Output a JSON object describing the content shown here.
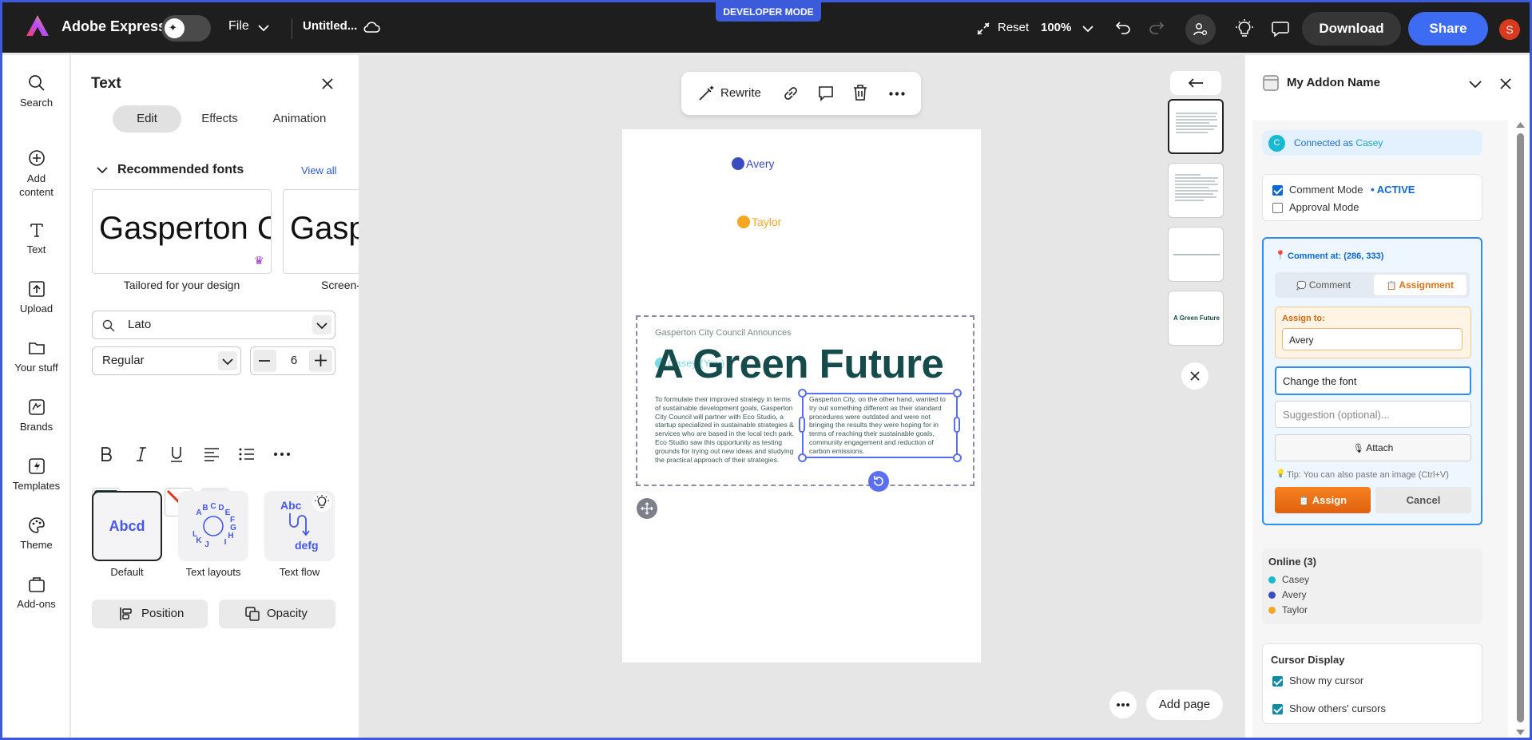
{
  "topbar": {
    "developer_mode": "DEVELOPER MODE",
    "app_name": "Adobe Express",
    "file_label": "File",
    "doc_title": "Untitled...",
    "reset_label": "Reset",
    "zoom": "100%",
    "download_label": "Download",
    "share_label": "Share",
    "avatar_initial": "S"
  },
  "rail": {
    "items": [
      {
        "label": "Search",
        "icon": "search-icon"
      },
      {
        "label": "Add content",
        "icon": "plus-circle-icon"
      },
      {
        "label": "Text",
        "icon": "text-icon"
      },
      {
        "label": "Upload",
        "icon": "upload-icon"
      },
      {
        "label": "Your stuff",
        "icon": "folder-icon"
      },
      {
        "label": "Brands",
        "icon": "brand-icon"
      },
      {
        "label": "Templates",
        "icon": "templates-icon"
      },
      {
        "label": "Theme",
        "icon": "palette-icon"
      },
      {
        "label": "Add-ons",
        "icon": "addons-icon"
      }
    ]
  },
  "text_panel": {
    "title": "Text",
    "tabs": [
      "Edit",
      "Effects",
      "Animation"
    ],
    "active_tab": "Edit",
    "recommended_title": "Recommended fonts",
    "view_all": "View all",
    "font_cards": [
      {
        "preview": "Gasperton C",
        "caption": "Tailored for your design"
      },
      {
        "preview": "Gasp",
        "caption": "Screen-"
      }
    ],
    "font_family": "Lato",
    "font_weight": "Regular",
    "font_size": "6",
    "text_color": "#164b4b",
    "presets": [
      {
        "label": "Default",
        "preview": "Abcd"
      },
      {
        "label": "Text layouts",
        "preview": "ABCDEFGHIJKL"
      },
      {
        "label": "Text flow",
        "preview_top": "Abc",
        "preview_bottom": "defg"
      }
    ],
    "position_label": "Position",
    "opacity_label": "Opacity"
  },
  "canvas": {
    "context_toolbar": {
      "rewrite_label": "Rewrite"
    },
    "cursors": [
      {
        "name": "Avery",
        "color": "#3b4cc0"
      },
      {
        "name": "Taylor",
        "color": "#f5a623"
      },
      {
        "name": "Casey (You)",
        "color": "#17b9d3"
      }
    ],
    "page": {
      "kicker": "Gasperton City Council Announces",
      "headline": "A Green Future",
      "col1": "To formulate their improved strategy in terms of sustainable development goals, Gasperton City Council will partner with Eco Studio, a startup specialized in sustainable strategies & services who are based in the local tech park. Eco Studio saw this opportunity as testing grounds for trying out new ideas and studying the practical approach of their strategies.",
      "col2": "Gasperton City, on the other hand, wanted to try out something different as their standard procedures were outdated and were not bringing the results they were hoping for in terms of reaching their sustainable goals, community engagement and reduction of carbon emissions."
    },
    "thumb_4_text": "A Green Future",
    "add_page_label": "Add page"
  },
  "addon": {
    "title": "My Addon Name",
    "connected_prefix": "Connected as",
    "connected_user": "Casey",
    "connected_initial": "C",
    "comment_mode_label": "Comment Mode",
    "comment_mode_status": "• ACTIVE",
    "approval_mode_label": "Approval Mode",
    "comment_at": "Comment at: (286, 333)",
    "tab_comment": "Comment",
    "tab_assignment": "Assignment",
    "assign_to_label": "Assign to:",
    "assign_to_value": "Avery",
    "comment_text": "Change the font",
    "suggestion_placeholder": "Suggestion (optional)...",
    "attach_label": "Attach",
    "tip": "Tip: You can also paste an image (Ctrl+V)",
    "assign_btn": "Assign",
    "cancel_btn": "Cancel",
    "online_title": "Online (3)",
    "online": [
      {
        "name": "Casey",
        "color": "#17b9d3"
      },
      {
        "name": "Avery",
        "color": "#3b4cc0"
      },
      {
        "name": "Taylor",
        "color": "#f5a623"
      }
    ],
    "cursor_display_title": "Cursor Display",
    "show_my_cursor": "Show my cursor",
    "show_others_cursors": "Show others' cursors"
  }
}
